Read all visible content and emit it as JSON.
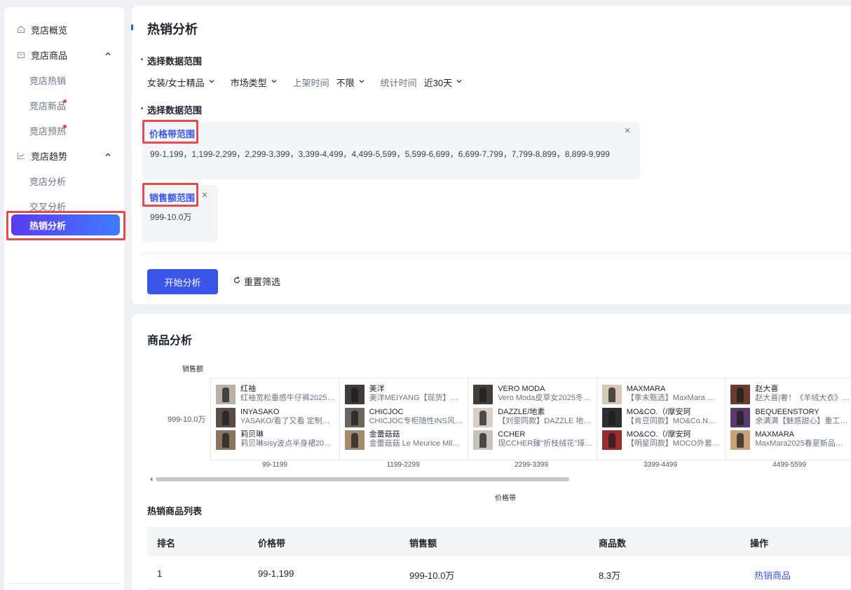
{
  "sidebar": {
    "overview": "竞店概览",
    "goods_group": "竞店商品",
    "goods_items": [
      {
        "label": "竞店热销",
        "badge": false
      },
      {
        "label": "竞店新品",
        "badge": true
      },
      {
        "label": "竞店预热",
        "badge": true
      }
    ],
    "trend_group": "竞店趋势",
    "trend_items": [
      {
        "label": "竞店分析"
      },
      {
        "label": "交叉分析"
      }
    ],
    "active": "热销分析"
  },
  "header": {
    "title": "热销分析"
  },
  "filters_section": {
    "title": "选择数据范围",
    "category": "女装/女士精品",
    "market": "市场类型",
    "listing_label": "上架时间",
    "listing_value": "不限",
    "stat_label": "统计时间",
    "stat_value": "近30天"
  },
  "range_section": {
    "title": "选择数据范围",
    "price": {
      "title": "价格带范围",
      "values": "99-1,199，1,199-2,299，2,299-3,399，3,399-4,499，4,499-5,599，5,599-6,699，6,699-7,799，7,799-8,899，8,899-9,999"
    },
    "sales": {
      "title": "销售额范围",
      "values": "999-10.0万"
    },
    "close_icon": "×"
  },
  "actions": {
    "start": "开始分析",
    "reset": "重置筛选"
  },
  "analysis": {
    "title": "商品分析",
    "y_label": "销售额",
    "y_value": "999-10.0万",
    "x_title": "价格带",
    "x_labels": [
      "99-1199",
      "1199-2299",
      "2299-3399",
      "3399-4499",
      "4499-5599"
    ],
    "cells": [
      [
        {
          "brand": "红袖",
          "desc": "红袖宽松垂感牛仔裤2025…",
          "color": "#b9b1a6"
        },
        {
          "brand": "INYASAKO",
          "desc": "YASAKO/看了又看 定制…",
          "color": "#5a4d48"
        },
        {
          "brand": "莉贝琳",
          "desc": "莉贝琳sisy波点半身裙202…",
          "color": "#8a7561"
        }
      ],
      [
        {
          "brand": "美洋",
          "desc": "美洋MEIYANG【现货】…",
          "color": "#3f3b3a"
        },
        {
          "brand": "CHICJOC",
          "desc": "CHICJOC专柜随性INS风…",
          "color": "#6b6560"
        },
        {
          "brand": "金蕾菇菇",
          "desc": "金蕾菇菇 Le Meurice Mila…",
          "color": "#a58a6e"
        }
      ],
      [
        {
          "brand": "VERO MODA",
          "desc": "Vero Moda皮草女2025冬…",
          "color": "#433d3b"
        },
        {
          "brand": "DAZZLE/地素",
          "desc": "【刘雯同款】DAZZLE 地…",
          "color": "#d9cfc4"
        },
        {
          "brand": "CCHER",
          "desc": "现CCHER臻\"折枝绒花\"璋…",
          "color": "#c7c2ba"
        }
      ],
      [
        {
          "brand": "MAXMARA",
          "desc": "【季末甄选】MaxMara 秋…",
          "color": "#d6c9b8"
        },
        {
          "brand": "MO&CO.（/摩安珂",
          "desc": "【肯豆同款】MO&Co.NO…",
          "color": "#2f2d2e"
        },
        {
          "brand": "MO&CO.（/摩安珂",
          "desc": "【明星同款】MOCO外套…",
          "color": "#9c2c2c"
        }
      ],
      [
        {
          "brand": "赵大喜",
          "desc": "赵大喜|奢！《羊绒大衣》…",
          "color": "#6a3b2e"
        },
        {
          "brand": "BEQUEENSTORY",
          "desc": "余满满【魅惑甜心】重工…",
          "color": "#5a3a6a"
        },
        {
          "brand": "MAXMARA",
          "desc": "MaxMara2025春夏新品女…",
          "color": "#c9a27c"
        }
      ]
    ]
  },
  "hot_list": {
    "title": "热销商品列表",
    "headers": [
      "排名",
      "价格带",
      "销售额",
      "商品数",
      "操作"
    ],
    "rows": [
      {
        "rank": "1",
        "price": "99-1,199",
        "sales": "999-10.0万",
        "count": "8.3万",
        "action": "热销商品"
      }
    ]
  }
}
